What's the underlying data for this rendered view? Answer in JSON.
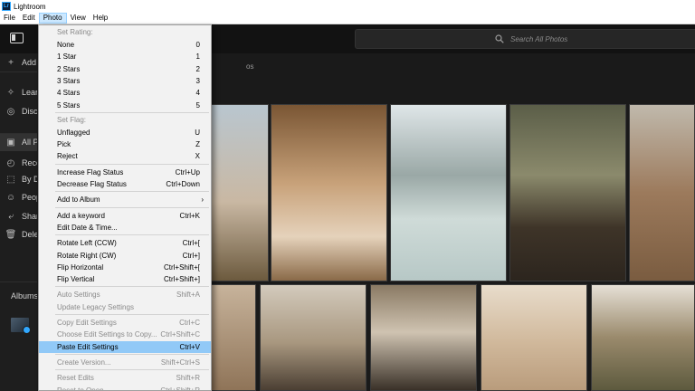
{
  "window": {
    "title": "Lightroom",
    "app_icon_text": "Lr"
  },
  "menubar": {
    "items": [
      {
        "label": "File"
      },
      {
        "label": "Edit"
      },
      {
        "label": "Photo"
      },
      {
        "label": "View"
      },
      {
        "label": "Help"
      }
    ],
    "active_index": 2
  },
  "search": {
    "placeholder": "Search All Photos"
  },
  "sidebar": {
    "rows": [
      {
        "icon": "+",
        "label": "Add Photos"
      },
      {
        "icon": "✧",
        "label": "Learn"
      },
      {
        "icon": "◎",
        "label": "Discover"
      },
      {
        "icon": "▣",
        "label": "All Photos"
      },
      {
        "icon": "◴",
        "label": "Recent"
      },
      {
        "icon": "⬚",
        "label": "By Date"
      },
      {
        "icon": "☺",
        "label": "People"
      },
      {
        "icon": "⤶",
        "label": "Shared"
      },
      {
        "icon": "🗑",
        "label": "Deleted"
      }
    ],
    "albums_label": "Albums"
  },
  "grid": {
    "sort_label": "os"
  },
  "photo_menu": {
    "items": [
      {
        "type": "header",
        "label": "Set Rating:"
      },
      {
        "type": "item",
        "label": "None",
        "shortcut": "0"
      },
      {
        "type": "item",
        "label": "1 Star",
        "shortcut": "1"
      },
      {
        "type": "item",
        "label": "2 Stars",
        "shortcut": "2"
      },
      {
        "type": "item",
        "label": "3 Stars",
        "shortcut": "3"
      },
      {
        "type": "item",
        "label": "4 Stars",
        "shortcut": "4"
      },
      {
        "type": "item",
        "label": "5 Stars",
        "shortcut": "5"
      },
      {
        "type": "sep"
      },
      {
        "type": "header",
        "label": "Set Flag:"
      },
      {
        "type": "item",
        "label": "Unflagged",
        "shortcut": "U"
      },
      {
        "type": "item",
        "label": "Pick",
        "shortcut": "Z"
      },
      {
        "type": "item",
        "label": "Reject",
        "shortcut": "X"
      },
      {
        "type": "sep"
      },
      {
        "type": "item",
        "label": "Increase Flag Status",
        "shortcut": "Ctrl+Up"
      },
      {
        "type": "item",
        "label": "Decrease Flag Status",
        "shortcut": "Ctrl+Down"
      },
      {
        "type": "sep"
      },
      {
        "type": "item",
        "label": "Add to Album",
        "submenu": true
      },
      {
        "type": "sep"
      },
      {
        "type": "item",
        "label": "Add a keyword",
        "shortcut": "Ctrl+K"
      },
      {
        "type": "item",
        "label": "Edit Date & Time..."
      },
      {
        "type": "sep"
      },
      {
        "type": "item",
        "label": "Rotate Left (CCW)",
        "shortcut": "Ctrl+["
      },
      {
        "type": "item",
        "label": "Rotate Right (CW)",
        "shortcut": "Ctrl+]"
      },
      {
        "type": "item",
        "label": "Flip Horizontal",
        "shortcut": "Ctrl+Shift+["
      },
      {
        "type": "item",
        "label": "Flip Vertical",
        "shortcut": "Ctrl+Shift+]"
      },
      {
        "type": "sep"
      },
      {
        "type": "item",
        "label": "Auto Settings",
        "shortcut": "Shift+A",
        "disabled": true
      },
      {
        "type": "item",
        "label": "Update Legacy Settings",
        "disabled": true
      },
      {
        "type": "sep"
      },
      {
        "type": "item",
        "label": "Copy Edit Settings",
        "shortcut": "Ctrl+C",
        "disabled": true
      },
      {
        "type": "item",
        "label": "Choose Edit Settings to Copy...",
        "shortcut": "Ctrl+Shift+C",
        "disabled": true
      },
      {
        "type": "item",
        "label": "Paste Edit Settings",
        "shortcut": "Ctrl+V",
        "highlighted": true
      },
      {
        "type": "sep"
      },
      {
        "type": "item",
        "label": "Create Version...",
        "shortcut": "Shift+Ctrl+S",
        "disabled": true
      },
      {
        "type": "sep"
      },
      {
        "type": "item",
        "label": "Reset Edits",
        "shortcut": "Shift+R",
        "disabled": true
      },
      {
        "type": "item",
        "label": "Reset to Open",
        "shortcut": "Ctrl+Shift+R",
        "disabled": true
      }
    ]
  },
  "colors": {
    "menu_highlight": "#91c9f7",
    "accent": "#31a8ff",
    "app_bg": "#1a1a1a"
  }
}
